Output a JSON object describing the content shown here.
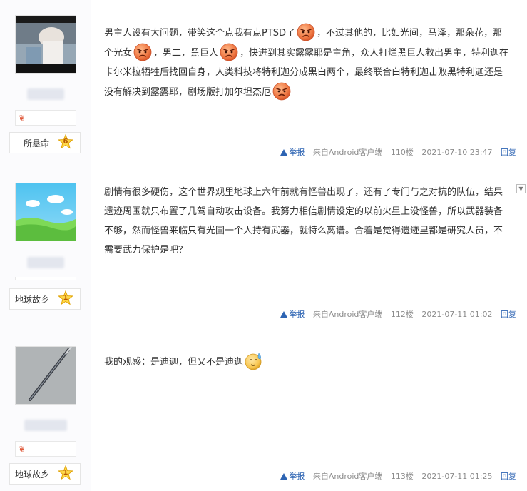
{
  "posts": [
    {
      "text_parts": [
        "男主人设有大问题，带笑这个点我有点PTSD了",
        "，不过其他的，比如光间，马泽，那朵花，那个光女",
        "，男二，黑巨人",
        "，快进到其实露露耶是主角，众人打烂黑巨人救出男主，特利迦在卡尔米拉牺牲后找回自身，人类科技将特利迦分成黑白两个，最终联合白特利迦击败黑特利迦还是没有解决到露露耶，剧场版打加尔坦杰厄",
        ""
      ],
      "emoticons": [
        "angry-face-icon",
        "angry-face-icon",
        "angry-face-icon",
        "angry-face-icon"
      ],
      "user_title": "一所悬命",
      "level": "6",
      "report": "举报",
      "source": "来自Android客户端",
      "floor": "110楼",
      "time": "2021-07-10 23:47",
      "reply": "回复"
    },
    {
      "text": "剧情有很多硬伤，这个世界观里地球上六年前就有怪兽出现了，还有了专门与之对抗的队伍，结果遗迹周围就只布置了几驾自动攻击设备。我努力相信剧情设定的以前火星上没怪兽，所以武器装备不够，然而怪兽来临只有光国一个人持有武器，就特么离谱。合着是觉得遗迹里都是研究人员，不需要武力保护是吧？",
      "user_title": "地球故乡",
      "level": "1",
      "report": "举报",
      "source": "来自Android客户端",
      "floor": "112楼",
      "time": "2021-07-11 01:02",
      "reply": "回复"
    },
    {
      "text": "我的观感：是迪迦，但又不是迪迦",
      "emoticon": "sweat-face-icon",
      "user_title": "地球故乡",
      "level": "1",
      "report": "举报",
      "source": "来自Android客户端",
      "floor": "113楼",
      "time": "2021-07-11 01:25",
      "reply": "回复"
    }
  ],
  "colors": {
    "link": "#2d64b3",
    "meta": "#8d8d8d",
    "sidebar": "#fbfbfd",
    "divider": "#e4e6eb"
  }
}
